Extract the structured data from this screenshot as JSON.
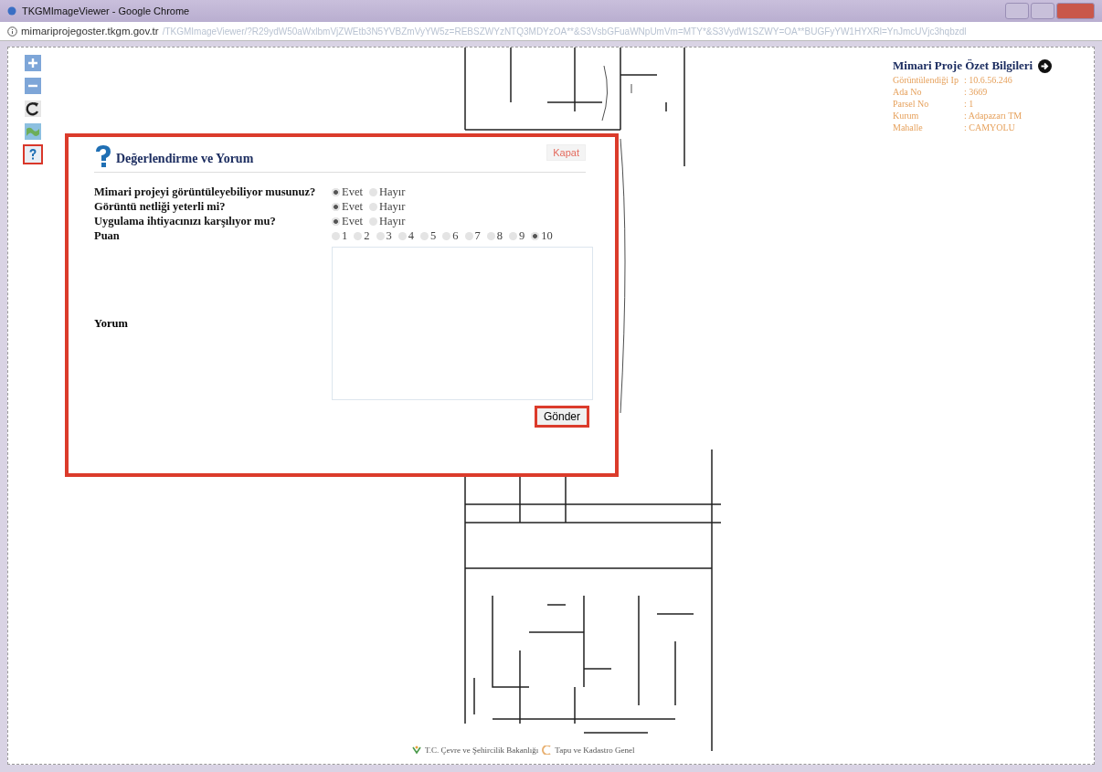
{
  "window": {
    "title": "TKGMImageViewer - Google Chrome"
  },
  "address_bar": {
    "host": "mimariprojegoster.tkgm.gov.tr",
    "path": "/TKGMImageViewer/?R29ydW50aWxlbmVjZWEtb3N5YVBZmVyYW5z=REBSZWYzNTQ3MDYzOA**&S3VsbGFuaWNpUmVm=MTY*&S3VydW1SZWY=OA**BUGFyYW1HYXRl=YnJmcUVjc3hqbzdl"
  },
  "tools": [
    {
      "kind": "zoom-in",
      "selected": false
    },
    {
      "kind": "zoom-out",
      "selected": false
    },
    {
      "kind": "rotate",
      "selected": false
    },
    {
      "kind": "map",
      "selected": false
    },
    {
      "kind": "help",
      "selected": true
    }
  ],
  "info_panel": {
    "title": "Mimari Proje Özet Bilgileri",
    "rows": [
      {
        "label": "Görüntülendiği Ip",
        "value": ": 10.6.56.246"
      },
      {
        "label": "Ada No",
        "value": ": 3669"
      },
      {
        "label": "Parsel No",
        "value": ": 1"
      },
      {
        "label": "Kurum",
        "value": ": Adapazarı TM"
      },
      {
        "label": "Mahalle",
        "value": ": CAMYOLU"
      }
    ]
  },
  "dialog": {
    "title": "Değerlendirme ve Yorum",
    "close_label": "Kapat",
    "questions": [
      {
        "label": "Mimari projeyi görüntüleyebiliyor musunuz?",
        "options": [
          {
            "label": "Evet",
            "selected": true
          },
          {
            "label": "Hayır",
            "selected": false
          }
        ]
      },
      {
        "label": "Görüntü netliği yeterli mi?",
        "options": [
          {
            "label": "Evet",
            "selected": true
          },
          {
            "label": "Hayır",
            "selected": false
          }
        ]
      },
      {
        "label": "Uygulama ihtiyacınızı karşılıyor mu?",
        "options": [
          {
            "label": "Evet",
            "selected": true
          },
          {
            "label": "Hayır",
            "selected": false
          }
        ]
      },
      {
        "label": "Puan",
        "options": [
          {
            "label": "1",
            "selected": false
          },
          {
            "label": "2",
            "selected": false
          },
          {
            "label": "3",
            "selected": false
          },
          {
            "label": "4",
            "selected": false
          },
          {
            "label": "5",
            "selected": false
          },
          {
            "label": "6",
            "selected": false
          },
          {
            "label": "7",
            "selected": false
          },
          {
            "label": "8",
            "selected": false
          },
          {
            "label": "9",
            "selected": false
          },
          {
            "label": "10",
            "selected": true
          }
        ]
      }
    ],
    "comment_label": "Yorum",
    "submit": "Gönder"
  },
  "footer": {
    "texts": [
      "T.C. Çevre ve Şehircilik Bakanlığı",
      "Tapu ve Kadastro Genel"
    ]
  }
}
